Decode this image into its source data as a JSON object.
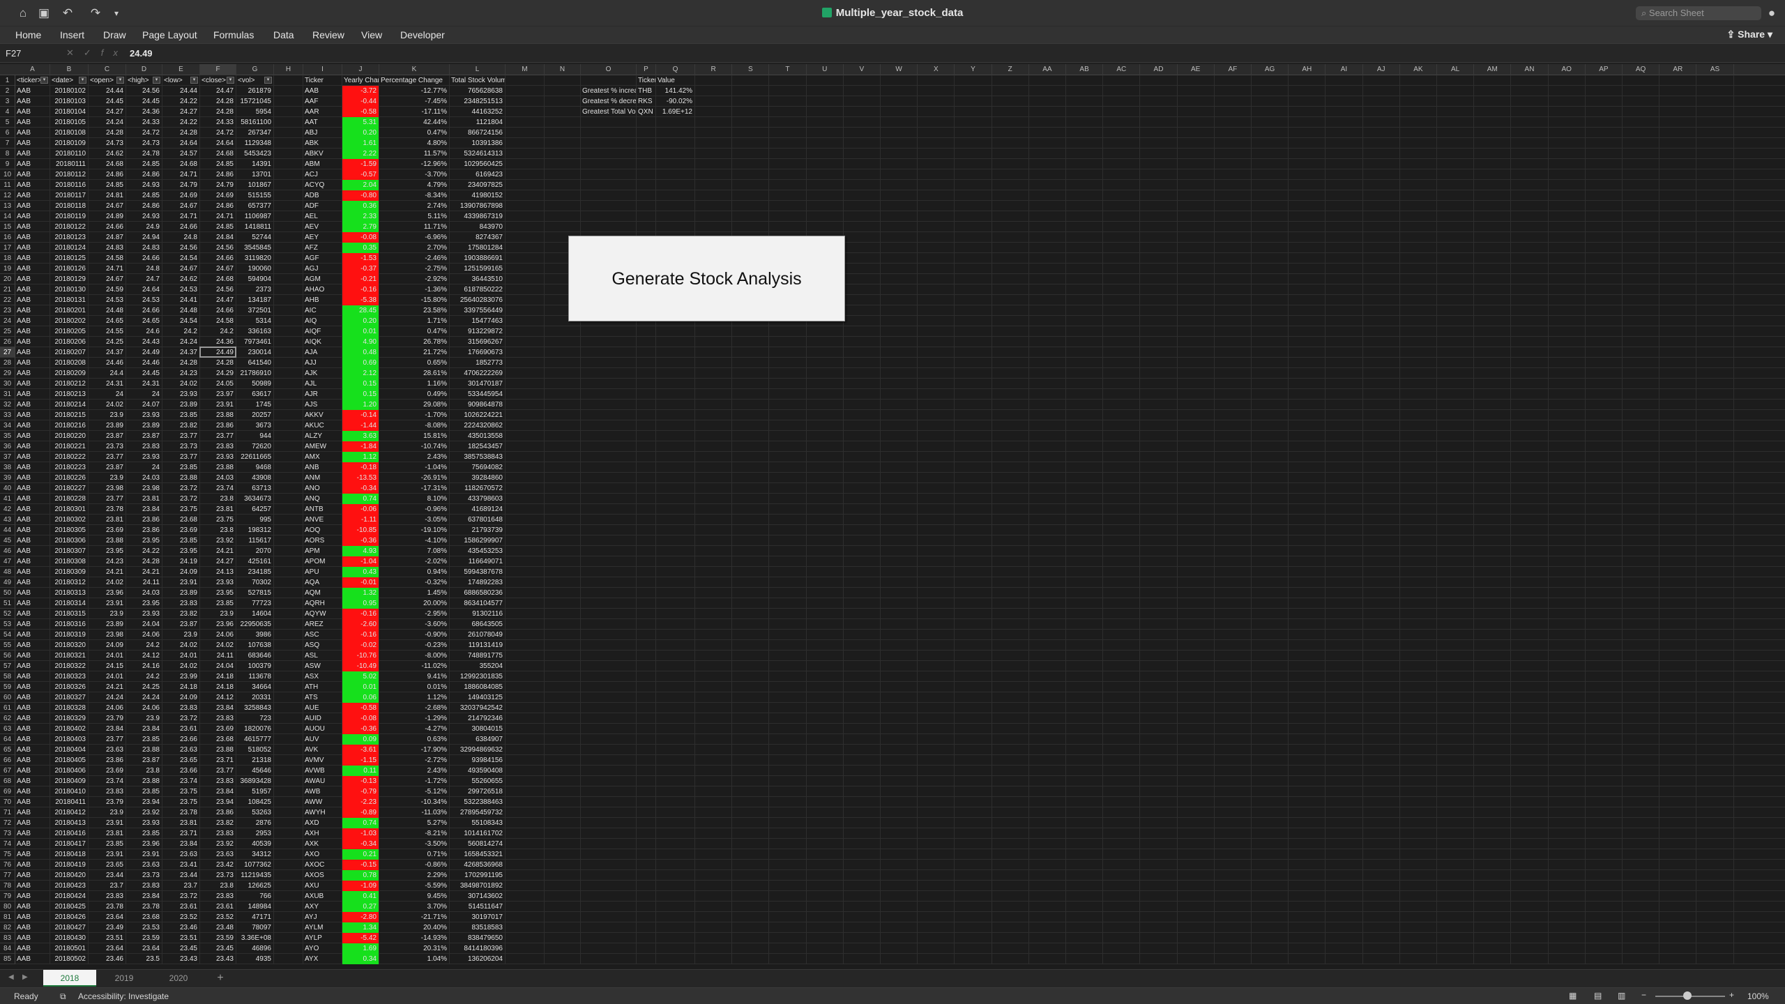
{
  "window": {
    "title": "Multiple_year_stock_data",
    "search_placeholder": "Search Sheet",
    "share": "Share"
  },
  "ribbon": {
    "tabs": [
      "Home",
      "Insert",
      "Draw",
      "Page Layout",
      "Formulas",
      "Data",
      "Review",
      "View",
      "Developer"
    ]
  },
  "formula_bar": {
    "cell_ref": "F27",
    "value": "24.49"
  },
  "columns": [
    "A",
    "B",
    "C",
    "D",
    "E",
    "F",
    "G",
    "H",
    "I",
    "J",
    "K",
    "L",
    "M",
    "N",
    "O",
    "P",
    "Q",
    "R",
    "S",
    "T",
    "U",
    "V",
    "W",
    "X",
    "Y",
    "Z",
    "AA",
    "AB",
    "AC",
    "AD",
    "AE",
    "AF",
    "AG",
    "AH",
    "AI",
    "AJ",
    "AK",
    "AL",
    "AM",
    "AN",
    "AO",
    "AP",
    "AQ",
    "AR",
    "AS"
  ],
  "headers": {
    "A": "<ticker>",
    "B": "<date>",
    "C": "<open>",
    "D": "<high>",
    "E": "<low>",
    "F": "<close>",
    "G": "<vol>",
    "I": "Ticker",
    "J": "Yearly Change",
    "K": "Percentage Change",
    "L": "Total Stock Volume",
    "O": "",
    "P": "Ticker",
    "Q": "Value"
  },
  "rows": [
    [
      "AAB",
      "20180102",
      "24.44",
      "24.56",
      "24.44",
      "24.47",
      "261879",
      "AAB",
      "-3.72",
      "-12.77%",
      "765628638"
    ],
    [
      "AAB",
      "20180103",
      "24.45",
      "24.45",
      "24.22",
      "24.28",
      "15721045",
      "AAF",
      "-0.44",
      "-7.45%",
      "2348251513"
    ],
    [
      "AAB",
      "20180104",
      "24.27",
      "24.36",
      "24.27",
      "24.28",
      "5954",
      "AAR",
      "-0.58",
      "-17.11%",
      "44163252"
    ],
    [
      "AAB",
      "20180105",
      "24.24",
      "24.33",
      "24.22",
      "24.33",
      "58161100",
      "AAT",
      "5.31",
      "42.44%",
      "1121804"
    ],
    [
      "AAB",
      "20180108",
      "24.28",
      "24.72",
      "24.28",
      "24.72",
      "267347",
      "ABJ",
      "0.20",
      "0.47%",
      "866724156"
    ],
    [
      "AAB",
      "20180109",
      "24.73",
      "24.73",
      "24.64",
      "24.64",
      "1129348",
      "ABK",
      "1.61",
      "4.80%",
      "10391386"
    ],
    [
      "AAB",
      "20180110",
      "24.62",
      "24.78",
      "24.57",
      "24.68",
      "5453423",
      "ABKV",
      "2.22",
      "11.57%",
      "5324614313"
    ],
    [
      "AAB",
      "20180111",
      "24.68",
      "24.85",
      "24.68",
      "24.85",
      "14391",
      "ABM",
      "-1.59",
      "-12.96%",
      "1029560425"
    ],
    [
      "AAB",
      "20180112",
      "24.86",
      "24.86",
      "24.71",
      "24.86",
      "13701",
      "ACJ",
      "-0.57",
      "-3.70%",
      "6169423"
    ],
    [
      "AAB",
      "20180116",
      "24.85",
      "24.93",
      "24.79",
      "24.79",
      "101867",
      "ACYQ",
      "2.04",
      "4.79%",
      "234097825"
    ],
    [
      "AAB",
      "20180117",
      "24.81",
      "24.85",
      "24.69",
      "24.69",
      "515155",
      "ADB",
      "-0.80",
      "-8.34%",
      "41980152"
    ],
    [
      "AAB",
      "20180118",
      "24.67",
      "24.86",
      "24.67",
      "24.86",
      "657377",
      "ADF",
      "0.36",
      "2.74%",
      "13907867898"
    ],
    [
      "AAB",
      "20180119",
      "24.89",
      "24.93",
      "24.71",
      "24.71",
      "1106987",
      "AEL",
      "2.33",
      "5.11%",
      "4339867319"
    ],
    [
      "AAB",
      "20180122",
      "24.66",
      "24.9",
      "24.66",
      "24.85",
      "1418811",
      "AEV",
      "2.79",
      "11.71%",
      "843970"
    ],
    [
      "AAB",
      "20180123",
      "24.87",
      "24.94",
      "24.8",
      "24.84",
      "52744",
      "AEY",
      "-0.08",
      "-6.96%",
      "8274367"
    ],
    [
      "AAB",
      "20180124",
      "24.83",
      "24.83",
      "24.56",
      "24.56",
      "3545845",
      "AFZ",
      "0.35",
      "2.70%",
      "175801284"
    ],
    [
      "AAB",
      "20180125",
      "24.58",
      "24.66",
      "24.54",
      "24.66",
      "3119820",
      "AGF",
      "-1.53",
      "-2.46%",
      "1903886691"
    ],
    [
      "AAB",
      "20180126",
      "24.71",
      "24.8",
      "24.67",
      "24.67",
      "190060",
      "AGJ",
      "-0.37",
      "-2.75%",
      "1251599165"
    ],
    [
      "AAB",
      "20180129",
      "24.67",
      "24.7",
      "24.62",
      "24.68",
      "594904",
      "AGM",
      "-0.21",
      "-2.92%",
      "36443510"
    ],
    [
      "AAB",
      "20180130",
      "24.59",
      "24.64",
      "24.53",
      "24.56",
      "2373",
      "AHAO",
      "-0.16",
      "-1.36%",
      "6187850222"
    ],
    [
      "AAB",
      "20180131",
      "24.53",
      "24.53",
      "24.41",
      "24.47",
      "134187",
      "AHB",
      "-5.38",
      "-15.80%",
      "25640283076"
    ],
    [
      "AAB",
      "20180201",
      "24.48",
      "24.66",
      "24.48",
      "24.66",
      "372501",
      "AIC",
      "28.45",
      "23.58%",
      "3397556449"
    ],
    [
      "AAB",
      "20180202",
      "24.65",
      "24.65",
      "24.54",
      "24.58",
      "5314",
      "AIQ",
      "0.20",
      "1.71%",
      "15477463"
    ],
    [
      "AAB",
      "20180205",
      "24.55",
      "24.6",
      "24.2",
      "24.2",
      "336163",
      "AIQF",
      "0.01",
      "0.47%",
      "913229872"
    ],
    [
      "AAB",
      "20180206",
      "24.25",
      "24.43",
      "24.24",
      "24.36",
      "7973461",
      "AIQK",
      "4.90",
      "26.78%",
      "315696267"
    ],
    [
      "AAB",
      "20180207",
      "24.37",
      "24.49",
      "24.37",
      "24.49",
      "230014",
      "AJA",
      "0.48",
      "21.72%",
      "176690673"
    ],
    [
      "AAB",
      "20180208",
      "24.46",
      "24.46",
      "24.28",
      "24.28",
      "641540",
      "AJJ",
      "0.69",
      "0.65%",
      "1852773"
    ],
    [
      "AAB",
      "20180209",
      "24.4",
      "24.45",
      "24.23",
      "24.29",
      "21786910",
      "AJK",
      "2.12",
      "28.61%",
      "4706222269"
    ],
    [
      "AAB",
      "20180212",
      "24.31",
      "24.31",
      "24.02",
      "24.05",
      "50989",
      "AJL",
      "0.15",
      "1.16%",
      "301470187"
    ],
    [
      "AAB",
      "20180213",
      "24",
      "24",
      "23.93",
      "23.97",
      "63617",
      "AJR",
      "0.15",
      "0.49%",
      "533445954"
    ],
    [
      "AAB",
      "20180214",
      "24.02",
      "24.07",
      "23.89",
      "23.91",
      "1745",
      "AJS",
      "1.20",
      "29.08%",
      "909864878"
    ],
    [
      "AAB",
      "20180215",
      "23.9",
      "23.93",
      "23.85",
      "23.88",
      "20257",
      "AKKV",
      "-0.14",
      "-1.70%",
      "1026224221"
    ],
    [
      "AAB",
      "20180216",
      "23.89",
      "23.89",
      "23.82",
      "23.86",
      "3673",
      "AKUC",
      "-1.44",
      "-8.08%",
      "2224320862"
    ],
    [
      "AAB",
      "20180220",
      "23.87",
      "23.87",
      "23.77",
      "23.77",
      "944",
      "ALZY",
      "3.63",
      "15.81%",
      "435013558"
    ],
    [
      "AAB",
      "20180221",
      "23.73",
      "23.83",
      "23.73",
      "23.83",
      "72620",
      "AMEW",
      "-1.84",
      "-10.74%",
      "182543457"
    ],
    [
      "AAB",
      "20180222",
      "23.77",
      "23.93",
      "23.77",
      "23.93",
      "22611665",
      "AMX",
      "1.12",
      "2.43%",
      "3857538843"
    ],
    [
      "AAB",
      "20180223",
      "23.87",
      "24",
      "23.85",
      "23.88",
      "9468",
      "ANB",
      "-0.18",
      "-1.04%",
      "75694082"
    ],
    [
      "AAB",
      "20180226",
      "23.9",
      "24.03",
      "23.88",
      "24.03",
      "43908",
      "ANM",
      "-13.53",
      "-26.91%",
      "39284860"
    ],
    [
      "AAB",
      "20180227",
      "23.98",
      "23.98",
      "23.72",
      "23.74",
      "63713",
      "ANO",
      "-0.34",
      "-17.31%",
      "1182670572"
    ],
    [
      "AAB",
      "20180228",
      "23.77",
      "23.81",
      "23.72",
      "23.8",
      "3634673",
      "ANQ",
      "0.74",
      "8.10%",
      "433798603"
    ],
    [
      "AAB",
      "20180301",
      "23.78",
      "23.84",
      "23.75",
      "23.81",
      "64257",
      "ANTB",
      "-0.06",
      "-0.96%",
      "41689124"
    ],
    [
      "AAB",
      "20180302",
      "23.81",
      "23.86",
      "23.68",
      "23.75",
      "995",
      "ANVE",
      "-1.11",
      "-3.05%",
      "637801648"
    ],
    [
      "AAB",
      "20180305",
      "23.69",
      "23.86",
      "23.69",
      "23.8",
      "198312",
      "AOQ",
      "-10.85",
      "-19.10%",
      "21793739"
    ],
    [
      "AAB",
      "20180306",
      "23.88",
      "23.95",
      "23.85",
      "23.92",
      "115617",
      "AORS",
      "-0.36",
      "-4.10%",
      "1586299907"
    ],
    [
      "AAB",
      "20180307",
      "23.95",
      "24.22",
      "23.95",
      "24.21",
      "2070",
      "APM",
      "4.93",
      "7.08%",
      "435453253"
    ],
    [
      "AAB",
      "20180308",
      "24.23",
      "24.28",
      "24.19",
      "24.27",
      "425161",
      "APOM",
      "-1.04",
      "-2.02%",
      "116649071"
    ],
    [
      "AAB",
      "20180309",
      "24.21",
      "24.21",
      "24.09",
      "24.13",
      "234185",
      "APU",
      "0.43",
      "0.94%",
      "5994387678"
    ],
    [
      "AAB",
      "20180312",
      "24.02",
      "24.11",
      "23.91",
      "23.93",
      "70302",
      "AQA",
      "-0.01",
      "-0.32%",
      "174892283"
    ],
    [
      "AAB",
      "20180313",
      "23.96",
      "24.03",
      "23.89",
      "23.95",
      "527815",
      "AQM",
      "1.32",
      "1.45%",
      "6886580236"
    ],
    [
      "AAB",
      "20180314",
      "23.91",
      "23.95",
      "23.83",
      "23.85",
      "77723",
      "AQRH",
      "0.95",
      "20.00%",
      "8634104577"
    ],
    [
      "AAB",
      "20180315",
      "23.9",
      "23.93",
      "23.82",
      "23.9",
      "14604",
      "AQYW",
      "-0.16",
      "-2.95%",
      "91302116"
    ],
    [
      "AAB",
      "20180316",
      "23.89",
      "24.04",
      "23.87",
      "23.96",
      "22950635",
      "AREZ",
      "-2.60",
      "-3.60%",
      "68643505"
    ],
    [
      "AAB",
      "20180319",
      "23.98",
      "24.06",
      "23.9",
      "24.06",
      "3986",
      "ASC",
      "-0.16",
      "-0.90%",
      "261078049"
    ],
    [
      "AAB",
      "20180320",
      "24.09",
      "24.2",
      "24.02",
      "24.02",
      "107638",
      "ASQ",
      "-0.02",
      "-0.23%",
      "119131419"
    ],
    [
      "AAB",
      "20180321",
      "24.01",
      "24.12",
      "24.01",
      "24.11",
      "683646",
      "ASL",
      "-10.76",
      "-8.00%",
      "748891775"
    ],
    [
      "AAB",
      "20180322",
      "24.15",
      "24.16",
      "24.02",
      "24.04",
      "100379",
      "ASW",
      "-10.49",
      "-11.02%",
      "355204"
    ],
    [
      "AAB",
      "20180323",
      "24.01",
      "24.2",
      "23.99",
      "24.18",
      "113678",
      "ASX",
      "5.02",
      "9.41%",
      "12992301835"
    ],
    [
      "AAB",
      "20180326",
      "24.21",
      "24.25",
      "24.18",
      "24.18",
      "34664",
      "ATH",
      "0.01",
      "0.01%",
      "1886084085"
    ],
    [
      "AAB",
      "20180327",
      "24.24",
      "24.24",
      "24.09",
      "24.12",
      "20331",
      "ATS",
      "0.06",
      "1.12%",
      "149403125"
    ],
    [
      "AAB",
      "20180328",
      "24.06",
      "24.06",
      "23.83",
      "23.84",
      "3258843",
      "AUE",
      "-0.58",
      "-2.68%",
      "32037942542"
    ],
    [
      "AAB",
      "20180329",
      "23.79",
      "23.9",
      "23.72",
      "23.83",
      "723",
      "AUID",
      "-0.08",
      "-1.29%",
      "214792346"
    ],
    [
      "AAB",
      "20180402",
      "23.84",
      "23.84",
      "23.61",
      "23.69",
      "1820076",
      "AUOU",
      "-0.36",
      "-4.27%",
      "30804015"
    ],
    [
      "AAB",
      "20180403",
      "23.77",
      "23.85",
      "23.66",
      "23.68",
      "4615777",
      "AUV",
      "0.09",
      "0.63%",
      "6384907"
    ],
    [
      "AAB",
      "20180404",
      "23.63",
      "23.88",
      "23.63",
      "23.88",
      "518052",
      "AVK",
      "-3.61",
      "-17.90%",
      "32994869632"
    ],
    [
      "AAB",
      "20180405",
      "23.86",
      "23.87",
      "23.65",
      "23.71",
      "21318",
      "AVMV",
      "-1.15",
      "-2.72%",
      "93984156"
    ],
    [
      "AAB",
      "20180406",
      "23.69",
      "23.8",
      "23.66",
      "23.77",
      "45646",
      "AVWB",
      "0.11",
      "2.43%",
      "493590408"
    ],
    [
      "AAB",
      "20180409",
      "23.74",
      "23.88",
      "23.74",
      "23.83",
      "36893428",
      "AWAU",
      "-0.13",
      "-1.72%",
      "55260655"
    ],
    [
      "AAB",
      "20180410",
      "23.83",
      "23.85",
      "23.75",
      "23.84",
      "51957",
      "AWB",
      "-0.79",
      "-5.12%",
      "299726518"
    ],
    [
      "AAB",
      "20180411",
      "23.79",
      "23.94",
      "23.75",
      "23.94",
      "108425",
      "AWW",
      "-2.23",
      "-10.34%",
      "5322388463"
    ],
    [
      "AAB",
      "20180412",
      "23.9",
      "23.92",
      "23.78",
      "23.86",
      "53263",
      "AWYH",
      "-0.89",
      "-11.03%",
      "27895459732"
    ],
    [
      "AAB",
      "20180413",
      "23.91",
      "23.93",
      "23.81",
      "23.82",
      "2876",
      "AXD",
      "0.74",
      "5.27%",
      "55108343"
    ],
    [
      "AAB",
      "20180416",
      "23.81",
      "23.85",
      "23.71",
      "23.83",
      "2953",
      "AXH",
      "-1.03",
      "-8.21%",
      "1014161702"
    ],
    [
      "AAB",
      "20180417",
      "23.85",
      "23.96",
      "23.84",
      "23.92",
      "40539",
      "AXK",
      "-0.34",
      "-3.50%",
      "560814274"
    ],
    [
      "AAB",
      "20180418",
      "23.91",
      "23.91",
      "23.63",
      "23.63",
      "34312",
      "AXO",
      "0.21",
      "0.71%",
      "1658453321"
    ],
    [
      "AAB",
      "20180419",
      "23.65",
      "23.63",
      "23.41",
      "23.42",
      "1077362",
      "AXOC",
      "-0.15",
      "-0.86%",
      "4268536968"
    ],
    [
      "AAB",
      "20180420",
      "23.44",
      "23.73",
      "23.44",
      "23.73",
      "11219435",
      "AXOS",
      "0.78",
      "2.29%",
      "1702991195"
    ],
    [
      "AAB",
      "20180423",
      "23.7",
      "23.83",
      "23.7",
      "23.8",
      "126625",
      "AXU",
      "-1.09",
      "-5.59%",
      "38498701892"
    ],
    [
      "AAB",
      "20180424",
      "23.83",
      "23.84",
      "23.72",
      "23.83",
      "766",
      "AXUB",
      "0.41",
      "9.45%",
      "307143602"
    ],
    [
      "AAB",
      "20180425",
      "23.78",
      "23.78",
      "23.61",
      "23.61",
      "148984",
      "AXY",
      "0.27",
      "3.70%",
      "514511647"
    ],
    [
      "AAB",
      "20180426",
      "23.64",
      "23.68",
      "23.52",
      "23.52",
      "47171",
      "AYJ",
      "-2.80",
      "-21.71%",
      "30197017"
    ],
    [
      "AAB",
      "20180427",
      "23.49",
      "23.53",
      "23.46",
      "23.48",
      "78097",
      "AYLM",
      "1.34",
      "20.40%",
      "83518583"
    ],
    [
      "AAB",
      "20180430",
      "23.51",
      "23.59",
      "23.51",
      "23.59",
      "3.36E+08",
      "AYLP",
      "-5.42",
      "-14.93%",
      "838479650"
    ],
    [
      "AAB",
      "20180501",
      "23.64",
      "23.64",
      "23.45",
      "23.45",
      "46896",
      "AYO",
      "1.69",
      "20.31%",
      "8414180396"
    ],
    [
      "AAB",
      "20180502",
      "23.46",
      "23.5",
      "23.43",
      "23.43",
      "4935",
      "AYX",
      "0.34",
      "1.04%",
      "136206204"
    ]
  ],
  "summary": [
    {
      "label": "Greatest % increase",
      "ticker": "THB",
      "value": "141.42%"
    },
    {
      "label": "Greatest % decrease",
      "ticker": "RKS",
      "value": "-90.02%"
    },
    {
      "label": "Greatest Total Volume",
      "ticker": "QXN",
      "value": "1.69E+12"
    }
  ],
  "button": {
    "label": "Generate Stock Analysis"
  },
  "sheets": [
    "2018",
    "2019",
    "2020"
  ],
  "active_sheet": "2018",
  "status": {
    "ready": "Ready",
    "accessibility": "Accessibility: Investigate",
    "zoom": "100%"
  },
  "colors": {
    "positive": "#16e01c",
    "negative": "#ff1010",
    "active_tab": "#1f7a3e"
  }
}
